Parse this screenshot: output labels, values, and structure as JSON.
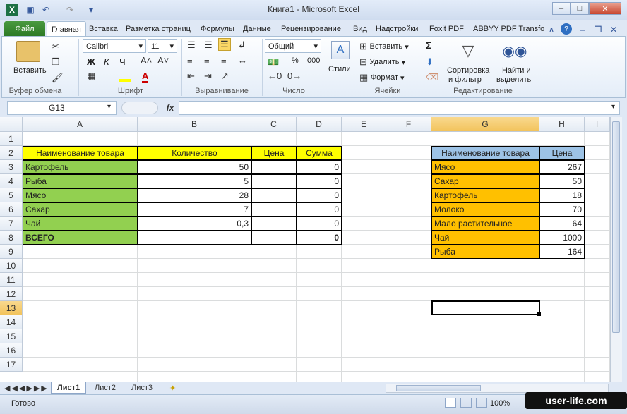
{
  "window": {
    "title": "Книга1  -  Microsoft Excel"
  },
  "tabs": {
    "file": "Файл",
    "items": [
      "Главная",
      "Вставка",
      "Разметка страниц",
      "Формулы",
      "Данные",
      "Рецензирование",
      "Вид",
      "Надстройки",
      "Foxit PDF",
      "ABBYY PDF Transfo"
    ]
  },
  "ribbon": {
    "clipboard": {
      "paste": "Вставить",
      "label": "Буфер обмена"
    },
    "font": {
      "name": "Calibri",
      "size": "11",
      "bold": "Ж",
      "italic": "К",
      "underline": "Ч",
      "color_letter": "A",
      "label": "Шрифт"
    },
    "alignment": {
      "label": "Выравнивание"
    },
    "number": {
      "format": "Общий",
      "percent": "%",
      "thousands": "000",
      "label": "Число"
    },
    "styles": {
      "label": "Стили"
    },
    "cells": {
      "insert": "Вставить",
      "delete": "Удалить",
      "format": "Формат",
      "label": "Ячейки"
    },
    "editing": {
      "sigma": "Σ",
      "sort_line1": "Сортировка",
      "sort_line2": "и фильтр",
      "find_line1": "Найти и",
      "find_line2": "выделить",
      "label": "Редактирование"
    }
  },
  "formula_bar": {
    "name": "G13",
    "fx": "fx",
    "value": ""
  },
  "columns": [
    "A",
    "B",
    "C",
    "D",
    "E",
    "F",
    "G",
    "H",
    "I"
  ],
  "rows": [
    "1",
    "2",
    "3",
    "4",
    "5",
    "6",
    "7",
    "8",
    "9",
    "10",
    "11",
    "12",
    "13",
    "14",
    "15",
    "16",
    "17"
  ],
  "table1": {
    "headers": [
      "Наименование товара",
      "Количество",
      "Цена",
      "Сумма"
    ],
    "rows": [
      [
        "Картофель",
        "50",
        "",
        "0"
      ],
      [
        "Рыба",
        "5",
        "",
        "0"
      ],
      [
        "Мясо",
        "28",
        "",
        "0"
      ],
      [
        "Сахар",
        "7",
        "",
        "0"
      ],
      [
        "Чай",
        "0,3",
        "",
        "0"
      ],
      [
        "ВСЕГО",
        "",
        "",
        "0"
      ]
    ]
  },
  "table2": {
    "headers": [
      "Наименование товара",
      "Цена"
    ],
    "rows": [
      [
        "Мясо",
        "267"
      ],
      [
        "Сахар",
        "50"
      ],
      [
        "Картофель",
        "18"
      ],
      [
        "Молоко",
        "70"
      ],
      [
        "Мало растительное",
        "64"
      ],
      [
        "Чай",
        "1000"
      ],
      [
        "Рыба",
        "164"
      ]
    ]
  },
  "sheets": [
    "Лист1",
    "Лист2",
    "Лист3"
  ],
  "status": {
    "ready": "Готово",
    "zoom": "100%"
  },
  "watermark": "user-life.com",
  "colors": {
    "header_yellow": "#ffff00",
    "green": "#92d050",
    "orange": "#ffc000",
    "blue": "#9dc3e6",
    "excel_green": "#2e7a25"
  }
}
